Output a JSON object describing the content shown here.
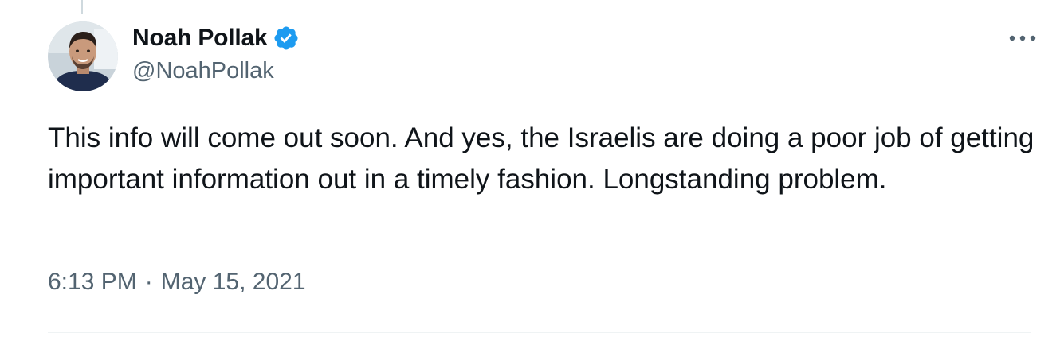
{
  "user": {
    "display_name": "Noah Pollak",
    "handle": "@NoahPollak",
    "verified": true
  },
  "tweet": {
    "text": "This info will come out soon. And yes, the Israelis are doing a poor job of getting important information out in a timely fashion. Longstanding problem.",
    "time": "6:13 PM",
    "separator": "·",
    "date": "May 15, 2021"
  },
  "icons": {
    "verified": "verified-badge-icon",
    "more": "more-options-icon"
  },
  "colors": {
    "text_primary": "#0f1419",
    "text_secondary": "#536471",
    "verified_blue": "#1d9bf0",
    "border": "#eff3f4"
  }
}
